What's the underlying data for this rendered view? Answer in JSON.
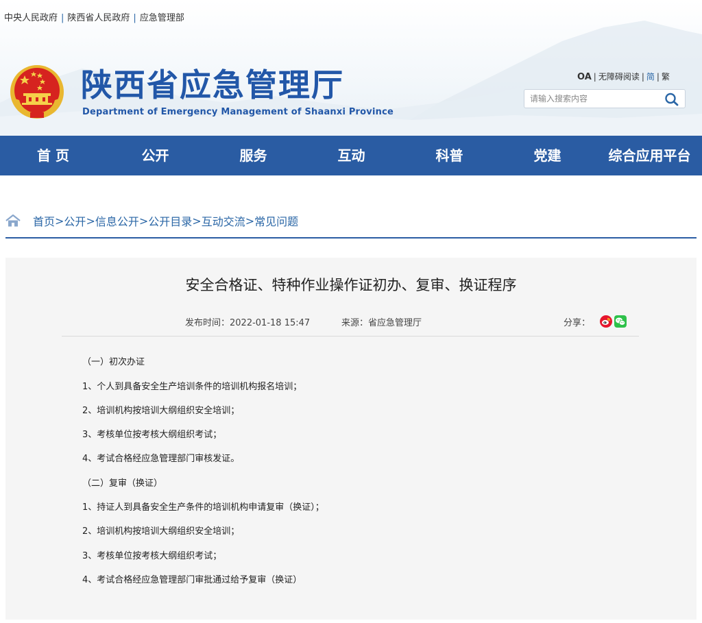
{
  "top_links": [
    "中央人民政府",
    "陕西省人民政府",
    "应急管理部"
  ],
  "site": {
    "title": "陕西省应急管理厅",
    "subtitle": "Department of Emergency Management of Shaanxi Province"
  },
  "tools": {
    "oa": "OA",
    "accessible": "无障碍阅读",
    "simplified": "简",
    "traditional": "繁",
    "separator": "|"
  },
  "search": {
    "placeholder": "请输入搜索内容",
    "value": ""
  },
  "nav": [
    "首 页",
    "公开",
    "服务",
    "互动",
    "科普",
    "党建",
    "综合应用平台"
  ],
  "breadcrumb": [
    "首页",
    "公开",
    "信息公开",
    "公开目录",
    "互动交流",
    "常见问题"
  ],
  "breadcrumb_separator": ">",
  "article": {
    "title": "安全合格证、特种作业操作证初办、复审、换证程序",
    "publish_label": "发布时间：",
    "publish_time": "2022-01-18 15:47",
    "source_label": "来源：",
    "source": "省应急管理厅",
    "share_label": "分享：",
    "paragraphs": [
      "（一）初次办证",
      "1、个人到具备安全生产培训条件的培训机构报名培训；",
      "2、培训机构按培训大纲组织安全培训；",
      "3、考核单位按考核大纲组织考试；",
      "4、考试合格经应急管理部门审核发证。",
      "（二）复审（换证）",
      "1、持证人到具备安全生产条件的培训机构申请复审（换证）；",
      "2、培训机构按培训大纲组织安全培训；",
      "3、考核单位按考核大纲组织考试；",
      "4、考试合格经应急管理部门审批通过给予复审（换证）"
    ]
  },
  "colors": {
    "brand_blue": "#2a5ca3",
    "title_blue": "#2257a8",
    "link_blue": "#2a66a6",
    "article_bg": "#f5f5f5",
    "emblem_red": "#d6231f",
    "emblem_gold": "#e9b730",
    "weibo_red": "#e6162d",
    "wechat_green": "#2ec14a"
  },
  "icons": {
    "emblem": "national-emblem",
    "search": "search-icon",
    "home": "home-icon",
    "weibo": "weibo-icon",
    "wechat": "wechat-icon"
  }
}
